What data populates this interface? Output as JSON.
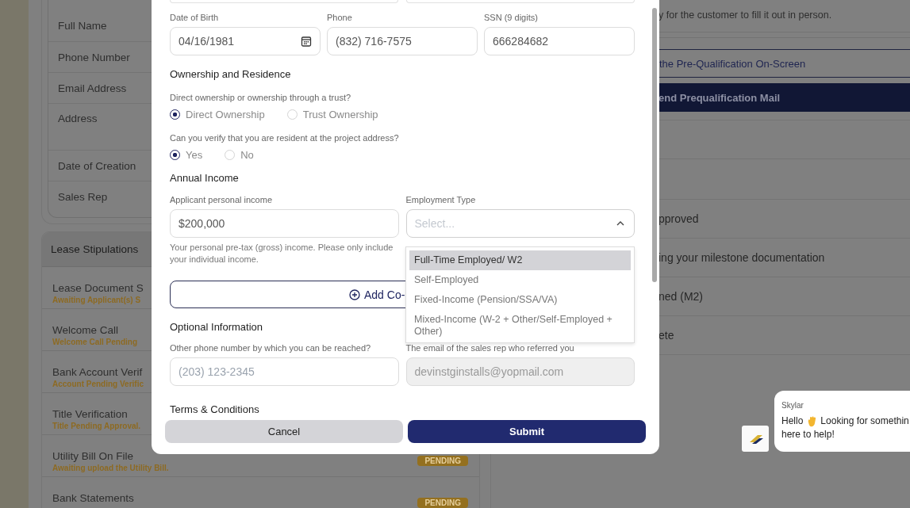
{
  "background": {
    "profile_rows": [
      {
        "label": "Full Name",
        "kind": "single"
      },
      {
        "label": "Phone Number",
        "kind": "single"
      },
      {
        "label": "Email Address",
        "kind": "single"
      },
      {
        "label": "Address",
        "kind": "multiline"
      },
      {
        "label": "Date of Creation",
        "kind": "single"
      },
      {
        "label": "Sales Rep",
        "kind": "single"
      }
    ],
    "stipulations": {
      "title": "Lease Stipulations",
      "items": [
        {
          "title": "Lease Document S",
          "note": "Awaiting Applicant(s) S"
        },
        {
          "title": "Welcome Call",
          "note": "Welcome Call Pending"
        },
        {
          "title": "Bank Account Verif",
          "note": "Account Pending Verific"
        },
        {
          "title": "Title Verification",
          "note": "Title Pending Approval."
        },
        {
          "title": "Utility Bill On File",
          "note": "Awaiting upload the Utility Bill.",
          "status": "PENDING"
        },
        {
          "title": "Bank Statements",
          "status": "PENDING"
        }
      ]
    },
    "prequal": {
      "note": "y for the customer to fill it out in person.",
      "onscreen_button": "the Pre-Qualification On-Screen",
      "mail_button": "end Prequalification Mail"
    },
    "milestones": [
      "pproved",
      "ing your milestone documentation",
      "ned (M2)",
      "ete"
    ]
  },
  "modal": {
    "personal_fields": [
      {
        "label": "Date of Birth",
        "value": "04/16/1981",
        "kind": "date"
      },
      {
        "label": "Phone",
        "value": "(832) 716-7575",
        "kind": "text"
      },
      {
        "label": "SSN (9 digits)",
        "value": "666284682",
        "kind": "text"
      }
    ],
    "ownership": {
      "heading": "Ownership and Residence",
      "questions": [
        {
          "question": "Direct ownership or ownership through a trust?",
          "options": [
            {
              "label": "Direct Ownership",
              "selected": true
            },
            {
              "label": "Trust Ownership",
              "selected": false
            }
          ]
        },
        {
          "question": "Can you verify that you are resident at the project address?",
          "options": [
            {
              "label": "Yes",
              "selected": true
            },
            {
              "label": "No",
              "selected": false
            }
          ]
        }
      ]
    },
    "income": {
      "heading": "Annual Income",
      "income_field": {
        "label": "Applicant personal income",
        "value": "$200,000",
        "help": "Your personal pre-tax (gross) income. Please only include your individual income."
      },
      "employment_field": {
        "label": "Employment Type",
        "placeholder": "Select...",
        "expanded": true,
        "options": [
          {
            "label": "Full-Time Employed/ W2",
            "selected": true
          },
          {
            "label": "Self-Employed",
            "selected": false
          },
          {
            "label": "Fixed-Income (Pension/SSA/VA)",
            "selected": false
          },
          {
            "label": "Mixed-Income (W-2 + Other/Self-Employed + Other)",
            "selected": false
          }
        ]
      }
    },
    "add_button": "Add Co-",
    "optional": {
      "heading": "Optional Information",
      "fields": [
        {
          "label": "Other phone number by which you can be reached?",
          "placeholder": "(203) 123-2345",
          "disabled": false
        },
        {
          "label": "The email of the sales rep who referred you",
          "value": "devinstginstalls@yopmail.com",
          "disabled": true
        }
      ]
    },
    "terms_heading": "Terms & Conditions",
    "buttons": {
      "cancel": "Cancel",
      "submit": "Submit"
    }
  },
  "chat": {
    "name": "Skylar",
    "greeting": "Hello",
    "message": "Looking for somethin",
    "message_line2": "here to help!"
  }
}
